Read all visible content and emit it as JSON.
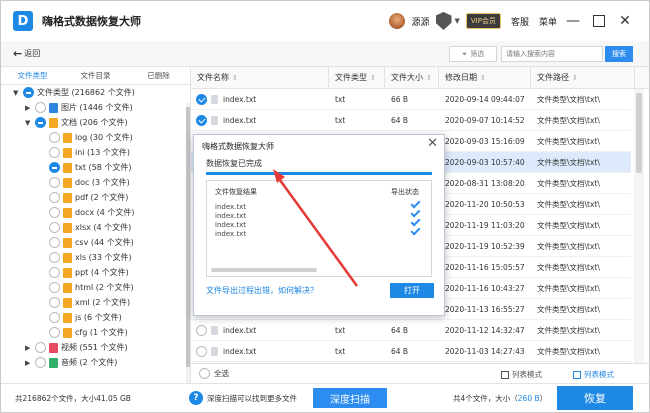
{
  "app": {
    "title": "嗨格式数据恢复大师",
    "logo_letter": "D"
  },
  "titlebar": {
    "user_name": "源源",
    "vip_badge": "VIP会员",
    "customer_service": "客服",
    "menu": "菜单",
    "minimize": "—",
    "close": "✕"
  },
  "toolbar": {
    "back": "返回",
    "filter": "筛选",
    "search_placeholder": "请输入搜索内容",
    "search_button": "搜索"
  },
  "left_tabs": [
    {
      "label": "文件类型",
      "active": true
    },
    {
      "label": "文件目录",
      "active": false
    },
    {
      "label": "已删除",
      "active": false
    }
  ],
  "tree": [
    {
      "label": "文件类型 (216862 个文件)",
      "level": 0,
      "expand": "▼",
      "check": "part",
      "icon": ""
    },
    {
      "label": "图片 (1446 个文件)",
      "level": 1,
      "expand": "▶",
      "check": "none",
      "icon": "blue"
    },
    {
      "label": "文档 (206 个文件)",
      "level": 1,
      "expand": "▼",
      "check": "part",
      "icon": "orange"
    },
    {
      "label": "log (30 个文件)",
      "level": 2,
      "expand": "",
      "check": "none",
      "icon": "orange"
    },
    {
      "label": "ini (13 个文件)",
      "level": 2,
      "expand": "",
      "check": "none",
      "icon": "orange"
    },
    {
      "label": "txt (58 个文件)",
      "level": 2,
      "expand": "",
      "check": "part",
      "icon": "orange"
    },
    {
      "label": "doc (3 个文件)",
      "level": 2,
      "expand": "",
      "check": "none",
      "icon": "orange"
    },
    {
      "label": "pdf (2 个文件)",
      "level": 2,
      "expand": "",
      "check": "none",
      "icon": "orange"
    },
    {
      "label": "docx (4 个文件)",
      "level": 2,
      "expand": "",
      "check": "none",
      "icon": "orange"
    },
    {
      "label": "xlsx (4 个文件)",
      "level": 2,
      "expand": "",
      "check": "none",
      "icon": "orange"
    },
    {
      "label": "csv (44 个文件)",
      "level": 2,
      "expand": "",
      "check": "none",
      "icon": "orange"
    },
    {
      "label": "xls (33 个文件)",
      "level": 2,
      "expand": "",
      "check": "none",
      "icon": "orange"
    },
    {
      "label": "ppt (4 个文件)",
      "level": 2,
      "expand": "",
      "check": "none",
      "icon": "orange"
    },
    {
      "label": "html (2 个文件)",
      "level": 2,
      "expand": "",
      "check": "none",
      "icon": "orange"
    },
    {
      "label": "xml (2 个文件)",
      "level": 2,
      "expand": "",
      "check": "none",
      "icon": "orange"
    },
    {
      "label": "js (6 个文件)",
      "level": 2,
      "expand": "",
      "check": "none",
      "icon": "orange"
    },
    {
      "label": "cfg (1 个文件)",
      "level": 2,
      "expand": "",
      "check": "none",
      "icon": "orange"
    },
    {
      "label": "视频 (551 个文件)",
      "level": 1,
      "expand": "▶",
      "check": "none",
      "icon": "red"
    },
    {
      "label": "音频 (2 个文件)",
      "level": 1,
      "expand": "▶",
      "check": "none",
      "icon": "green"
    }
  ],
  "grid": {
    "columns": [
      "文件名称",
      "文件类型",
      "文件大小",
      "修改日期",
      "文件路径"
    ],
    "rows": [
      {
        "name": "index.txt",
        "type": "txt",
        "size": "66 B",
        "date": "2020-09-14 09:44:07",
        "path": "文件类型\\文档\\txt\\",
        "checked": true,
        "selected": false
      },
      {
        "name": "index.txt",
        "type": "txt",
        "size": "64 B",
        "date": "2020-09-07 10:14:52",
        "path": "文件类型\\文档\\txt\\",
        "checked": true,
        "selected": false
      },
      {
        "name": "",
        "type": "",
        "size": "",
        "date": "2020-09-03 15:16:09",
        "path": "文件类型\\文档\\txt\\",
        "checked": false,
        "selected": false
      },
      {
        "name": "",
        "type": "",
        "size": "",
        "date": "2020-09-03 10:57:40",
        "path": "文件类型\\文档\\txt\\",
        "checked": false,
        "selected": true
      },
      {
        "name": "",
        "type": "",
        "size": "",
        "date": "2020-08-31 13:08:20",
        "path": "文件类型\\文档\\txt\\",
        "checked": false,
        "selected": false
      },
      {
        "name": "",
        "type": "",
        "size": "",
        "date": "2020-11-20 10:50:53",
        "path": "文件类型\\文档\\txt\\",
        "checked": false,
        "selected": false
      },
      {
        "name": "",
        "type": "",
        "size": "",
        "date": "2020-11-19 11:03:20",
        "path": "文件类型\\文档\\txt\\",
        "checked": false,
        "selected": false
      },
      {
        "name": "",
        "type": "",
        "size": "",
        "date": "2020-11-19 10:52:39",
        "path": "文件类型\\文档\\txt\\",
        "checked": false,
        "selected": false
      },
      {
        "name": "",
        "type": "",
        "size": "",
        "date": "2020-11-16 15:05:57",
        "path": "文件类型\\文档\\txt\\",
        "checked": false,
        "selected": false
      },
      {
        "name": "",
        "type": "",
        "size": "",
        "date": "2020-11-16 10:43:27",
        "path": "文件类型\\文档\\txt\\",
        "checked": false,
        "selected": false
      },
      {
        "name": "",
        "type": "",
        "size": "",
        "date": "2020-11-13 16:55:27",
        "path": "文件类型\\文档\\txt\\",
        "checked": false,
        "selected": false
      },
      {
        "name": "index.txt",
        "type": "txt",
        "size": "64 B",
        "date": "2020-11-12 14:32:47",
        "path": "文件类型\\文档\\txt\\",
        "checked": false,
        "selected": false
      },
      {
        "name": "index.txt",
        "type": "txt",
        "size": "64 B",
        "date": "2020-11-03 14:27:43",
        "path": "文件类型\\文档\\txt\\",
        "checked": false,
        "selected": false
      }
    ]
  },
  "footer_bar": {
    "select_all": "全选",
    "list_mode": "列表模式",
    "thumb_mode": "列表模式"
  },
  "bottom": {
    "total": "共216862个文件，大小41.05 GB",
    "deep_hint": "深度扫描可以找到更多文件",
    "deep_button": "深度扫描",
    "sel_prefix": "共4个文件，大小（",
    "sel_size": "260 B",
    "sel_suffix": "）",
    "recover": "恢复"
  },
  "dialog": {
    "title": "嗨格式数据恢复大师",
    "close": "✕",
    "status": "数据恢复已完成",
    "progress": 1.0,
    "col_result": "文件恢复结果",
    "col_status": "导出状态",
    "results": [
      "index.txt",
      "index.txt",
      "index.txt",
      "index.txt"
    ],
    "help_link": "文件导出过程出错，如何解决？",
    "open_button": "打开"
  },
  "colors": {
    "accent": "#1e88e5",
    "arrow": "#e53935"
  }
}
